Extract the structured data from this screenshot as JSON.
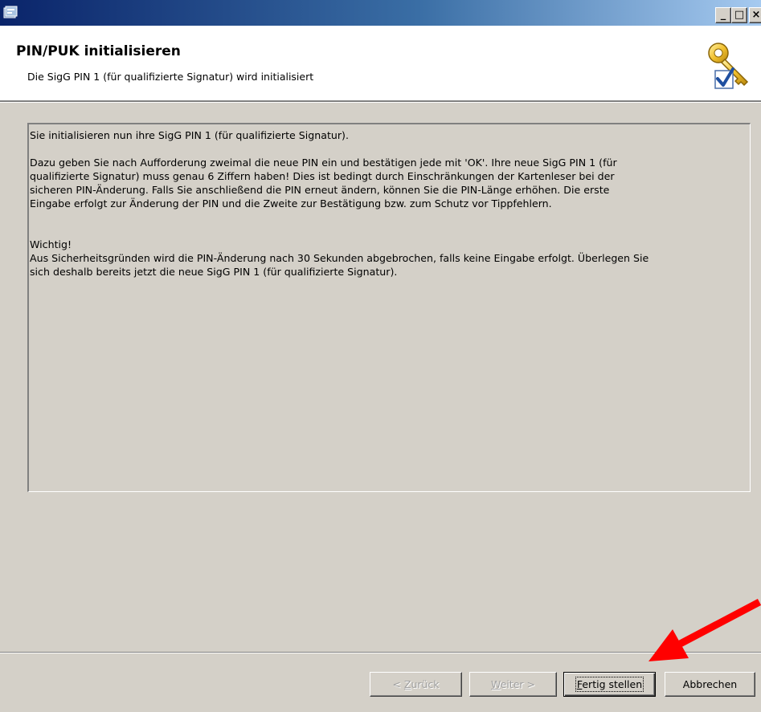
{
  "window": {
    "caption_buttons": {
      "minimize": "_",
      "maximize": "□",
      "close": "×"
    }
  },
  "header": {
    "title": "PIN/PUK initialisieren",
    "subtitle": "Die SigG PIN 1 (für qualifizierte Signatur) wird initialisiert",
    "icon": "key-checkmark-icon"
  },
  "content": {
    "line1": "Sie initialisieren nun ihre SigG PIN 1 (für qualifizierte Signatur).",
    "para2": [
      "Dazu geben Sie nach Aufforderung zweimal die neue PIN ein und bestätigen jede mit 'OK'. Ihre neue SigG PIN 1 (für",
      "qualifizierte Signatur) muss genau 6 Ziffern haben! Dies ist bedingt durch Einschränkungen der Kartenleser bei der",
      "sicheren PIN-Änderung. Falls Sie anschließend die PIN erneut ändern, können Sie die PIN-Länge erhöhen. Die erste",
      "Eingabe erfolgt zur Änderung der PIN und die Zweite zur Bestätigung bzw. zum Schutz vor Tippfehlern."
    ],
    "important_heading": "Wichtig!",
    "important": [
      "Aus Sicherheitsgründen wird die PIN-Änderung nach 30 Sekunden abgebrochen, falls keine Eingabe erfolgt. Überlegen Sie",
      "sich deshalb bereits jetzt die neue SigG PIN 1 (für qualifizierte Signatur)."
    ]
  },
  "buttons": {
    "back": {
      "prefix": "< ",
      "mnemonic": "Z",
      "rest": "urück",
      "enabled": false
    },
    "next": {
      "mnemonic": "W",
      "rest": "eiter >",
      "enabled": false
    },
    "finish": {
      "mnemonic": "F",
      "rest": "ertig stellen",
      "enabled": true,
      "default": true
    },
    "cancel": {
      "label": "Abbrechen",
      "enabled": true
    }
  },
  "colors": {
    "titlebar_start": "#0a246a",
    "titlebar_end": "#a6caf0",
    "dialog_face": "#d4d0c8",
    "annotation": "#ff0000"
  }
}
